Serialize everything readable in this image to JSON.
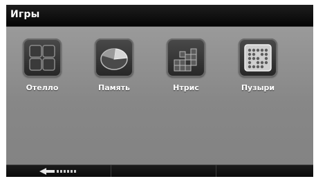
{
  "window": {
    "title": "Игры"
  },
  "apps": [
    {
      "label": "Отелло",
      "icon": "othello-grid-icon"
    },
    {
      "label": "Память",
      "icon": "pie-chart-icon"
    },
    {
      "label": "Нтрис",
      "icon": "tetris-blocks-icon"
    },
    {
      "label": "Пузыри",
      "icon": "bubbles-icon"
    }
  ],
  "bottom_bar": {
    "back_icon": "back-arrow-icon"
  }
}
